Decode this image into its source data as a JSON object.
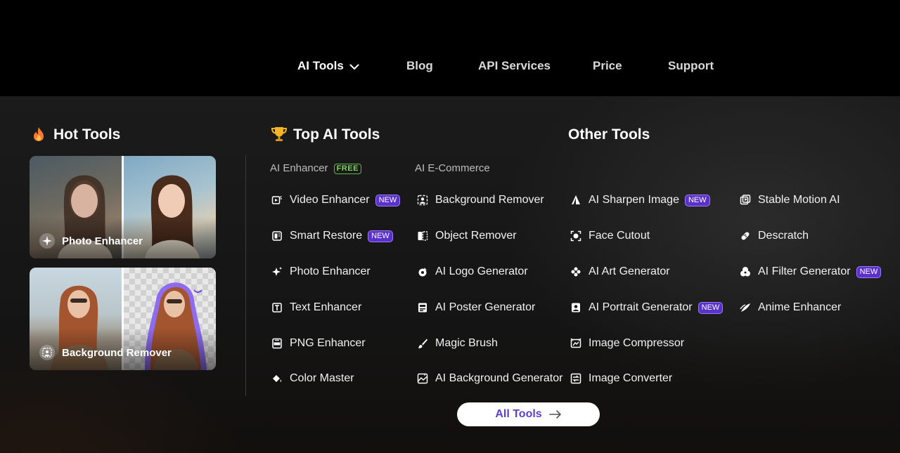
{
  "nav": {
    "items": [
      {
        "label": "AI Tools",
        "active": true,
        "has_dropdown": true
      },
      {
        "label": "Blog"
      },
      {
        "label": "API Services"
      },
      {
        "label": "Price"
      },
      {
        "label": "Support"
      }
    ]
  },
  "hot_tools": {
    "title": "Hot Tools",
    "icon": "fire-icon",
    "cards": [
      {
        "label": "Photo Enhancer",
        "icon": "sparkle-icon"
      },
      {
        "label": "Background Remover",
        "icon": "portrait-cutout-icon"
      }
    ]
  },
  "top_ai_tools": {
    "title": "Top AI Tools",
    "icon": "trophy-icon",
    "columns": [
      {
        "heading": "AI Enhancer",
        "heading_badge": "FREE",
        "items": [
          {
            "label": "Video Enhancer",
            "badge": "NEW",
            "icon": "video-icon"
          },
          {
            "label": "Smart Restore",
            "badge": "NEW",
            "icon": "restore-icon"
          },
          {
            "label": "Photo Enhancer",
            "icon": "sparkle-icon"
          },
          {
            "label": "Text Enhancer",
            "icon": "text-icon"
          },
          {
            "label": "PNG Enhancer",
            "icon": "png-icon"
          },
          {
            "label": "Color Master",
            "icon": "paint-bucket-icon"
          }
        ]
      },
      {
        "heading": "AI E-Commerce",
        "items": [
          {
            "label": "Background Remover",
            "icon": "bg-remove-icon"
          },
          {
            "label": "Object Remover",
            "icon": "object-remove-icon"
          },
          {
            "label": "AI Logo Generator",
            "icon": "logo-icon"
          },
          {
            "label": "AI Poster Generator",
            "icon": "poster-icon"
          },
          {
            "label": "Magic Brush",
            "icon": "brush-icon"
          },
          {
            "label": "AI Background Generator",
            "icon": "bg-generate-icon"
          }
        ]
      }
    ]
  },
  "other_tools": {
    "title": "Other Tools",
    "columns": [
      {
        "items": [
          {
            "label": "AI Sharpen Image",
            "badge": "NEW",
            "icon": "sharpen-icon"
          },
          {
            "label": "Face Cutout",
            "icon": "face-cutout-icon"
          },
          {
            "label": "AI Art Generator",
            "icon": "art-icon"
          },
          {
            "label": "AI Portrait Generator",
            "badge": "NEW",
            "icon": "portrait-icon"
          },
          {
            "label": "Image Compressor",
            "icon": "compress-icon"
          },
          {
            "label": "Image Converter",
            "icon": "convert-icon"
          }
        ]
      },
      {
        "items": [
          {
            "label": "Stable Motion AI",
            "icon": "motion-icon"
          },
          {
            "label": "Descratch",
            "icon": "descratch-icon"
          },
          {
            "label": "AI Filter Generator",
            "badge": "NEW",
            "icon": "filter-icon"
          },
          {
            "label": "Anime Enhancer",
            "icon": "anime-icon"
          }
        ]
      }
    ]
  },
  "all_tools_button": {
    "label": "All Tools",
    "icon": "arrow-right-icon"
  },
  "colors": {
    "badge_new": "#5b32c9",
    "free_badge": "#7cd65b",
    "button_text": "#5b3fd0",
    "background": "#000000"
  }
}
